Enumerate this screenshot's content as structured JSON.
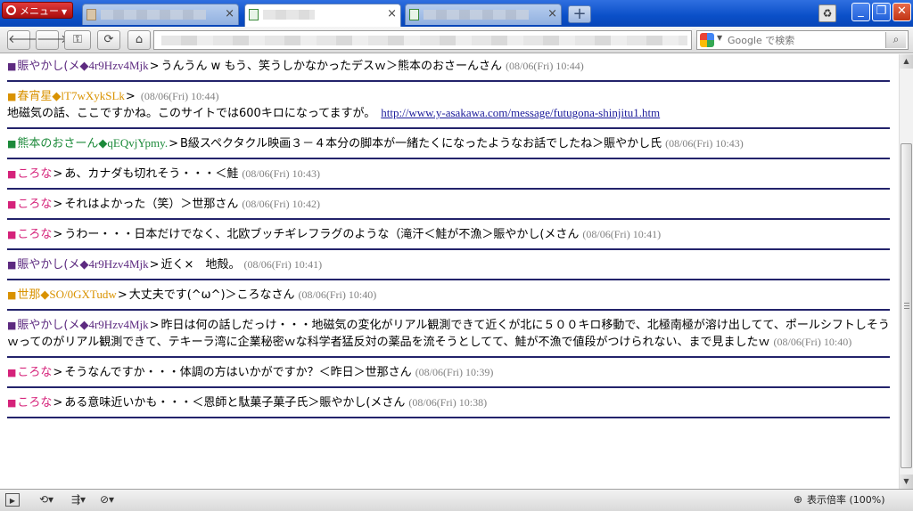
{
  "browser": {
    "menu_label": "メニュー",
    "new_tab_symbol": "+",
    "tabs": [
      {
        "icon": "blank-page-icon",
        "active": false
      },
      {
        "icon": "page-icon",
        "active": true
      },
      {
        "icon": "page-icon",
        "active": false
      }
    ],
    "tab_close_symbol": "×"
  },
  "toolbar": {
    "back": "🡐",
    "forward": "🡒",
    "wand": "⚿",
    "reload": "⟳",
    "home": "⌂",
    "search_placeholder": "Google で検索",
    "search_button": "⌕"
  },
  "posts": [
    {
      "color": "purple",
      "name": "賑やかし(メ",
      "trip": "◆4r9Hzv4Mjk",
      "text": "うんうん w もう、笑うしかなかったデスｗ＞熊本のおさーんさん",
      "date": "(08/06(Fri) 10:44)",
      "link": ""
    },
    {
      "color": "gold",
      "name": "春宵星",
      "trip": "◆lT7wXykSLk",
      "text": "",
      "date": "(08/06(Fri) 10:44)",
      "body2": "地磁気の話、ここですかね。このサイトでは600キロになってますが。",
      "link": "http://www.y-asakawa.com/message/futugona-shinjitu1.htm"
    },
    {
      "color": "green",
      "name": "熊本のおさーん",
      "trip": "◆qEQvjYpmy.",
      "text": "B級スペクタクル映画３－４本分の脚本が一緒たくになったようなお話でしたね＞賑やかし氏",
      "date": "(08/06(Fri) 10:43)",
      "link": ""
    },
    {
      "color": "pink",
      "name": "ころな",
      "trip": "",
      "text": "あ、カナダも切れそう・・・＜鮭",
      "date": "(08/06(Fri) 10:43)",
      "link": ""
    },
    {
      "color": "pink",
      "name": "ころな",
      "trip": "",
      "text": "それはよかった（笑）＞世那さん",
      "date": "(08/06(Fri) 10:42)",
      "link": ""
    },
    {
      "color": "pink",
      "name": "ころな",
      "trip": "",
      "text": "うわー・・・日本だけでなく、北欧ブッチギレフラグのような（滝汗＜鮭が不漁＞賑やかし(メさん",
      "date": "(08/06(Fri) 10:41)",
      "link": ""
    },
    {
      "color": "purple",
      "name": "賑やかし(メ",
      "trip": "◆4r9Hzv4Mjk",
      "text": "近く×　地殻。",
      "date": "(08/06(Fri) 10:41)",
      "link": ""
    },
    {
      "color": "gold",
      "name": "世那",
      "trip": "◆SO/0GXTudw",
      "text": "大丈夫です(^ω^)＞ころなさん",
      "date": "(08/06(Fri) 10:40)",
      "link": ""
    },
    {
      "color": "purple",
      "name": "賑やかし(メ",
      "trip": "◆4r9Hzv4Mjk",
      "text": "昨日は何の話しだっけ・・・地磁気の変化がリアル観測できて近くが北に５００キロ移動で、北極南極が溶け出してて、ポールシフトしそうｗってのがリアル観測できて、テキーラ湾に企業秘密ｗな科学者猛反対の薬品を流そうとしてて、鮭が不漁で値段がつけられない、まで見ましたｗ",
      "date": "(08/06(Fri) 10:40)",
      "link": ""
    },
    {
      "color": "pink",
      "name": "ころな",
      "trip": "",
      "text": "そうなんですか・・・体調の方はいかがですか？＜昨日＞世那さん",
      "date": "(08/06(Fri) 10:39)",
      "link": ""
    },
    {
      "color": "pink",
      "name": "ころな",
      "trip": "",
      "text": "ある意味近いかも・・・＜恩師と駄菓子菓子氏＞賑やかし(メさん",
      "date": "(08/06(Fri) 10:38)",
      "link": ""
    }
  ],
  "statusbar": {
    "zoom_label": "表示倍率 (100%)"
  }
}
